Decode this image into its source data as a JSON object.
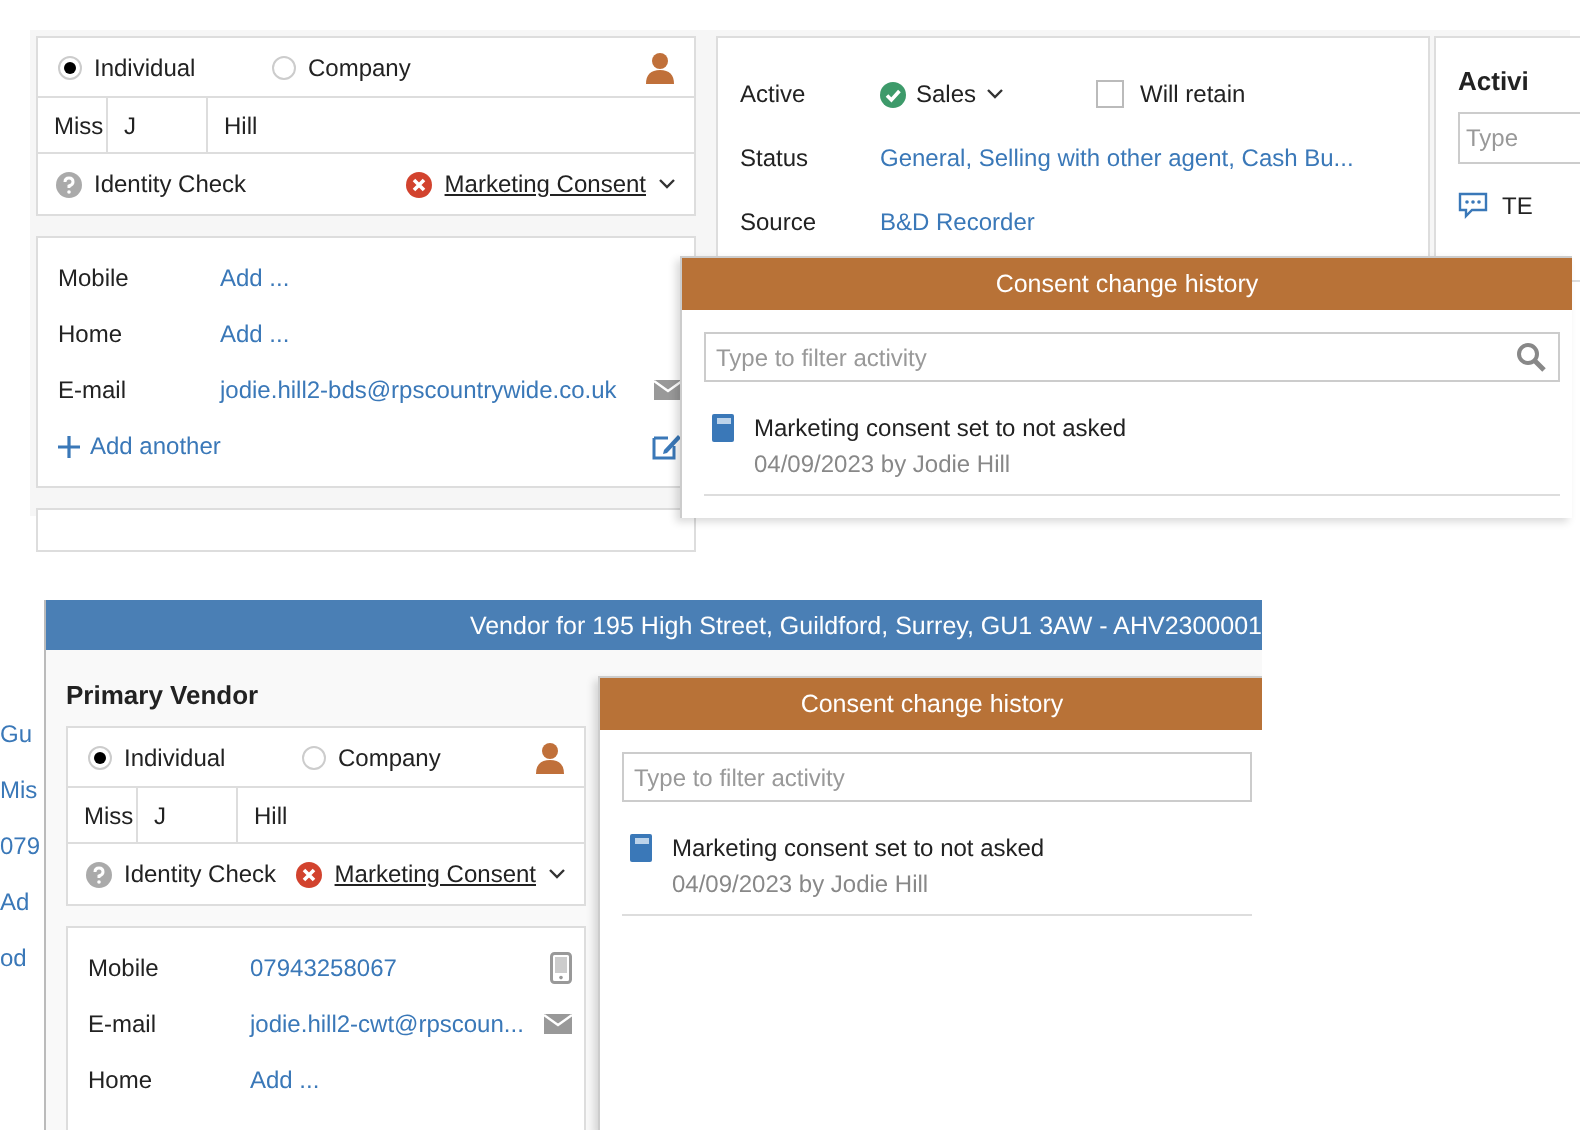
{
  "top": {
    "party": {
      "types": [
        {
          "label": "Individual",
          "selected": true
        },
        {
          "label": "Company",
          "selected": false
        }
      ],
      "name": {
        "title": "Miss",
        "first": "J",
        "last": "Hill"
      },
      "checks": [
        {
          "label": "Identity Check",
          "kind": "unknown",
          "dropdown": false
        },
        {
          "label": "Marketing Consent",
          "kind": "failed",
          "dropdown": true
        }
      ]
    },
    "contacts": [
      {
        "label": "Mobile",
        "value": "Add ..."
      },
      {
        "label": "Home",
        "value": "Add ..."
      },
      {
        "label": "E-mail",
        "value": "jodie.hill2-bds@rpscountrywide.co.uk",
        "kind": "email"
      }
    ],
    "add_another": "Add another",
    "details": {
      "rows": [
        {
          "label": "Active",
          "kind": "status",
          "badge": {
            "kind": "passed",
            "text": "Sales"
          },
          "checkbox": {
            "label": "Will retain",
            "checked": false
          }
        },
        {
          "label": "Status",
          "kind": "link",
          "value": "General, Selling with other agent, Cash Bu..."
        },
        {
          "label": "Source",
          "kind": "link",
          "value": "B&D Recorder"
        }
      ]
    },
    "activity": {
      "title": "Activi",
      "placeholder": "Type",
      "items": [
        {
          "text": "TE"
        }
      ]
    },
    "consent_history": {
      "title": "Consent change history",
      "placeholder": "Type to filter activity",
      "search_icon": true,
      "entries": [
        {
          "text": "Marketing consent set to not asked",
          "meta": "04/09/2023 by Jodie Hill"
        }
      ]
    }
  },
  "bottom": {
    "background_fragments": [
      "Gu",
      "Mis",
      "079",
      "Ad",
      "od"
    ],
    "title": "Vendor for 195 High Street, Guildford, Surrey, GU1 3AW - AHV2300001",
    "heading": "Primary Vendor",
    "party": {
      "types": [
        {
          "label": "Individual",
          "selected": true
        },
        {
          "label": "Company",
          "selected": false
        }
      ],
      "name": {
        "title": "Miss",
        "first": "J",
        "last": "Hill"
      },
      "checks": [
        {
          "label": "Identity Check",
          "kind": "unknown",
          "dropdown": false
        },
        {
          "label": "Marketing Consent",
          "kind": "failed",
          "dropdown": true
        }
      ]
    },
    "contacts": [
      {
        "label": "Mobile",
        "value": "07943258067",
        "kind": "phone"
      },
      {
        "label": "E-mail",
        "value": "jodie.hill2-cwt@rpscoun...",
        "kind": "email"
      },
      {
        "label": "Home",
        "value": "Add ..."
      }
    ],
    "consent_history": {
      "title": "Consent change history",
      "placeholder": "Type to filter activity",
      "search_icon": false,
      "entries": [
        {
          "text": "Marketing consent set to not asked",
          "meta": "04/09/2023 by Jodie Hill"
        }
      ]
    }
  }
}
